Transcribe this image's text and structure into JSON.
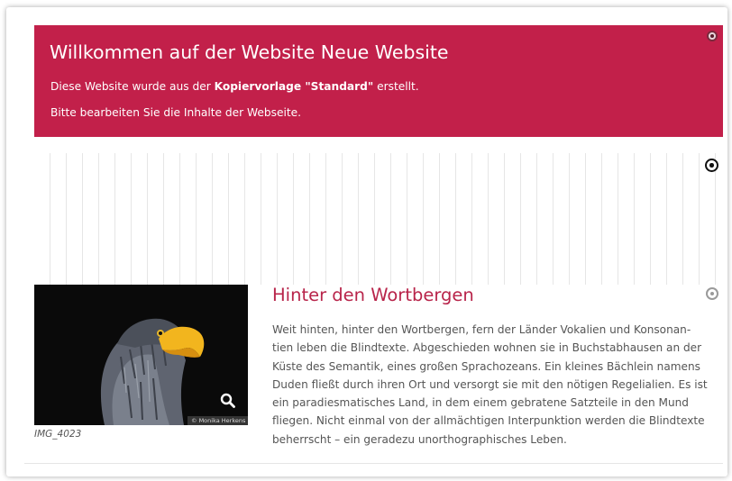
{
  "banner": {
    "title": "Willkommen auf der Website Neue Website",
    "line1_prefix": "Diese Website wurde aus der ",
    "line1_bold": "Kopiervorlage \"Standard\"",
    "line1_suffix": " erstellt.",
    "line2": "Bitte bearbeiten Sie die Inhalte der Webseite.",
    "color": "#c2204a"
  },
  "image": {
    "caption": "IMG_4023",
    "credit": "© Monika Herkens",
    "zoom_icon": "magnifier-icon"
  },
  "article": {
    "title": "Hinter den Wortbergen",
    "title_color": "#b8244a",
    "lines": [
      "Weit hinten, hinter den Wortbergen, fern der Länder Vokalien und Konsonan-",
      "tien leben die Blindtexte. Abgeschieden wohnen sie in Buchstabhausen an der",
      "Küste des Semantik, eines großen Sprachozeans. Ein kleines Bächlein namens",
      "Duden fließt durch ihren Ort und versorgt sie mit den nötigen Regelialien. Es ist",
      "ein paradiesmatisches Land, in dem einem gebratene Satzteile in den Mund",
      "fliegen. Nicht einmal von der allmächtigen Interpunktion werden die Blindtexte",
      "beherrscht – ein geradezu unorthographisches Leben."
    ]
  }
}
